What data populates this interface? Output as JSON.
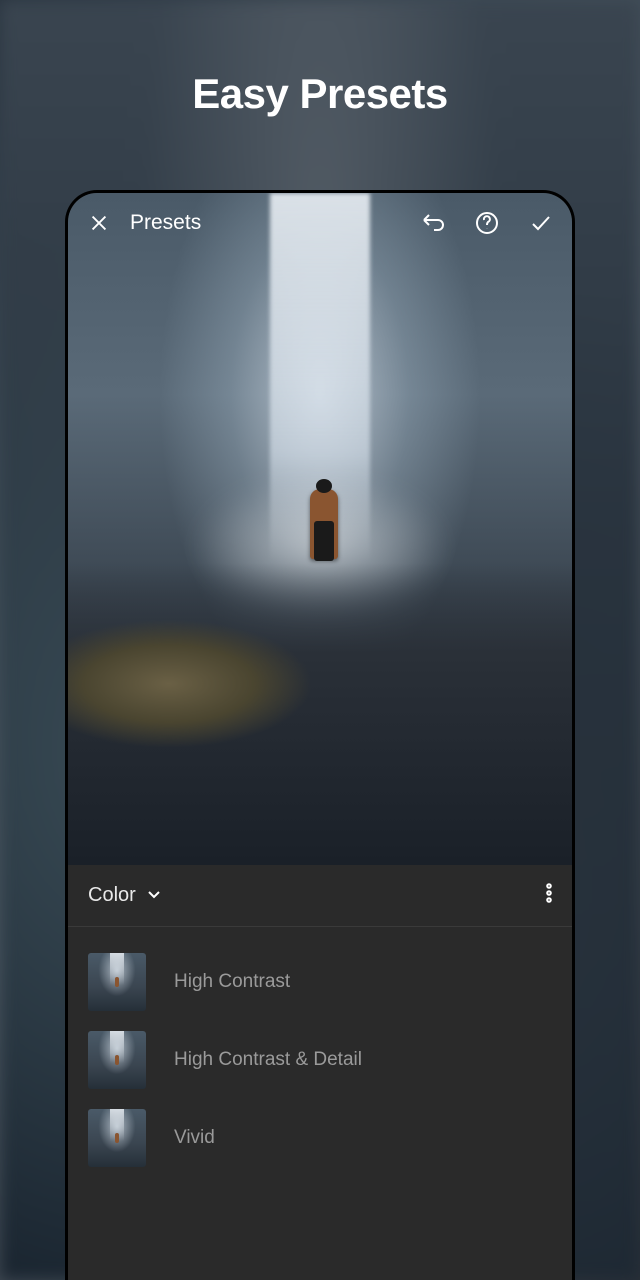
{
  "page": {
    "title": "Easy Presets"
  },
  "topbar": {
    "screen_title": "Presets"
  },
  "panel": {
    "category": "Color",
    "presets": [
      {
        "name": "High Contrast"
      },
      {
        "name": "High Contrast & Detail"
      },
      {
        "name": "Vivid"
      }
    ]
  }
}
